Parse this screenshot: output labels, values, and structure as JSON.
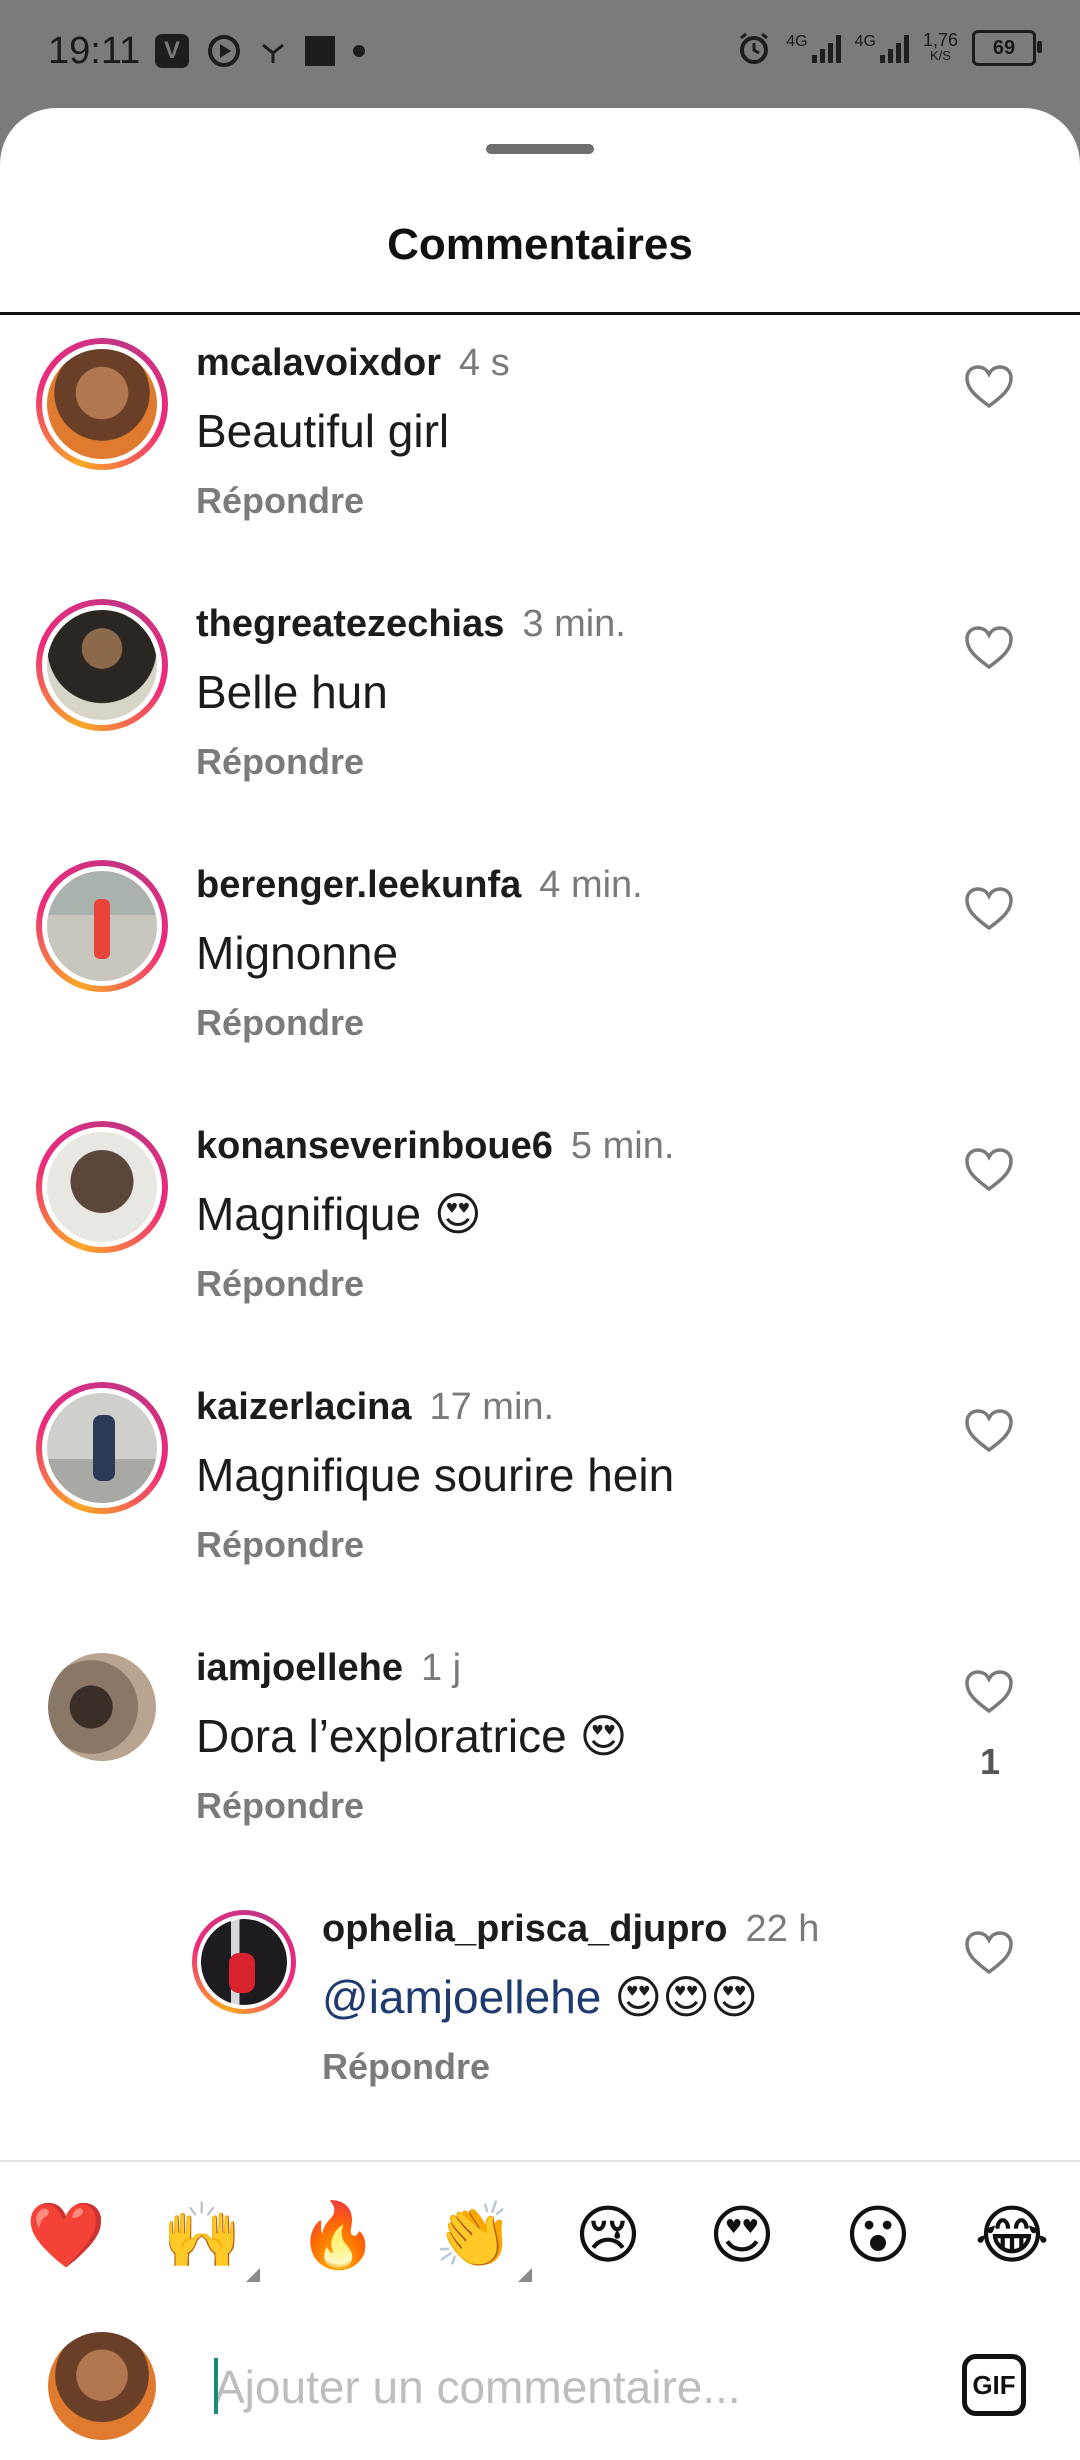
{
  "status_bar": {
    "time": "19:11",
    "app_icon_v": "V",
    "signal1_label": "4G",
    "signal2_label": "4G",
    "speed_value": "1,76",
    "speed_unit": "K/S",
    "battery": "69"
  },
  "sheet": {
    "title": "Commentaires"
  },
  "comments": [
    {
      "user": "mcalavoixdor",
      "time": "4 s",
      "text": "Beautiful girl",
      "reply_label": "Répondre",
      "likes": "",
      "avatar_color": "#8a5a3c"
    },
    {
      "user": "thegreatezechias",
      "time": "3 min.",
      "text": "Belle hun",
      "reply_label": "Répondre",
      "likes": "",
      "avatar_color": "#3c3a36"
    },
    {
      "user": "berenger.leekunfa",
      "time": "4 min.",
      "text": "Mignonne",
      "reply_label": "Répondre",
      "likes": "",
      "avatar_color": "#9fa7a3"
    },
    {
      "user": "konanseverinboue6",
      "time": "5 min.",
      "text": "Magnifique 😍",
      "reply_label": "Répondre",
      "likes": "",
      "avatar_color": "#5b4a40"
    },
    {
      "user": "kaizerlacina",
      "time": "17 min.",
      "text": "Magnifique sourire hein",
      "reply_label": "Répondre",
      "likes": "",
      "avatar_color": "#b9b9b6"
    },
    {
      "user": "iamjoellehe",
      "time": "1 j",
      "text": "Dora l’exploratrice 😍",
      "reply_label": "Répondre",
      "likes": "1",
      "avatar_color": "#6b5a4d"
    }
  ],
  "reply": {
    "user": "ophelia_prisca_djupro",
    "time": "22 h",
    "mention": "@iamjoellehe",
    "text": "😍😍😍",
    "reply_label": "Répondre",
    "avatar_color": "#2d2730"
  },
  "emoji_bar": [
    {
      "char": "❤️",
      "name": "heart"
    },
    {
      "char": "🙌",
      "name": "raising-hands"
    },
    {
      "char": "🔥",
      "name": "fire"
    },
    {
      "char": "👏",
      "name": "clapping-hands"
    },
    {
      "char": "😢",
      "name": "crying-face"
    },
    {
      "char": "😍",
      "name": "heart-eyes"
    },
    {
      "char": "😮",
      "name": "open-mouth"
    },
    {
      "char": "😂",
      "name": "tears-of-joy"
    }
  ],
  "composer": {
    "placeholder": "Ajouter un commentaire...",
    "gif_label": "GIF"
  },
  "colors": {
    "background_dim": "#7b7b7b",
    "mention": "#1e3a6e",
    "muted": "#7b7b7b"
  }
}
